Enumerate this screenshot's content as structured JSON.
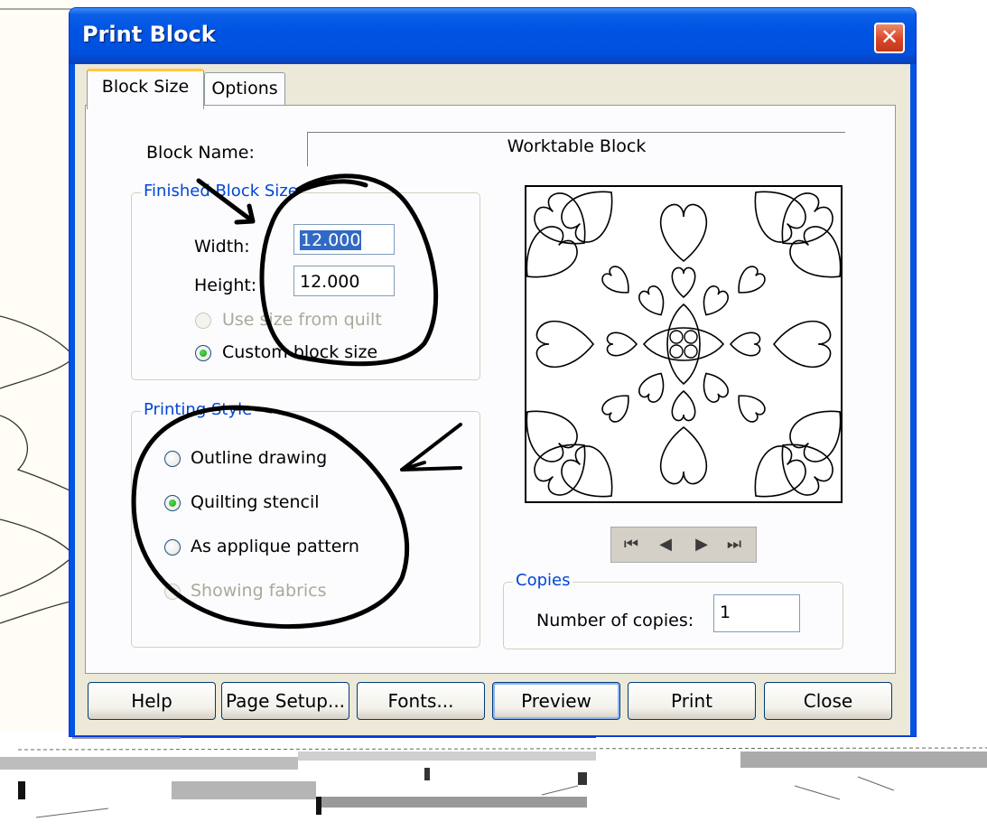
{
  "dialog": {
    "title": "Print Block",
    "close_glyph": "✕"
  },
  "tabs": [
    {
      "label": "Block Size",
      "active": true
    },
    {
      "label": "Options",
      "active": false
    }
  ],
  "block_name": {
    "label": "Block Name:",
    "value": "Worktable Block"
  },
  "finished_size": {
    "legend": "Finished Block Size",
    "width_label": "Width:",
    "width_value": "12.000",
    "height_label": "Height:",
    "height_value": "12.000",
    "use_quilt_label": "Use size from quilt",
    "custom_label": "Custom block size",
    "selected": "custom"
  },
  "printing_style": {
    "legend": "Printing Style",
    "options": [
      "Outline drawing",
      "Quilting stencil",
      "As applique pattern",
      "Showing fabrics"
    ],
    "selected": "Quilting stencil"
  },
  "preview_nav": {
    "first": "first-icon",
    "prev": "prev-icon",
    "next": "next-icon",
    "last": "last-icon"
  },
  "copies": {
    "legend": "Copies",
    "label": "Number of copies:",
    "value": "1"
  },
  "buttons": {
    "help": "Help",
    "page_setup": "Page Setup...",
    "fonts": "Fonts...",
    "preview": "Preview",
    "print": "Print",
    "close": "Close"
  },
  "colors": {
    "title_bar": "#0054e3",
    "accent": "#0046d5",
    "annotation_ink": "#000000"
  }
}
